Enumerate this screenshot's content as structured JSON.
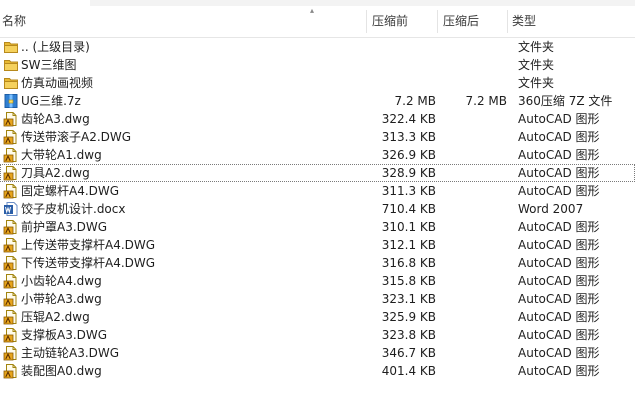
{
  "columns": {
    "name": "名称",
    "size_before": "压缩前",
    "size_after": "压缩后",
    "type": "类型"
  },
  "files": [
    {
      "name": ".. (上级目录)",
      "before": "",
      "after": "",
      "type": "文件夹",
      "icon": "folder-icon"
    },
    {
      "name": "SW三维图",
      "before": "",
      "after": "",
      "type": "文件夹",
      "icon": "folder-icon"
    },
    {
      "name": "仿真动画视频",
      "before": "",
      "after": "",
      "type": "文件夹",
      "icon": "folder-icon"
    },
    {
      "name": "UG三维.7z",
      "before": "7.2 MB",
      "after": "7.2 MB",
      "type": "360压缩 7Z 文件",
      "icon": "archive-icon"
    },
    {
      "name": "齿轮A3.dwg",
      "before": "322.4 KB",
      "after": "",
      "type": "AutoCAD 图形",
      "icon": "autocad-icon"
    },
    {
      "name": "传送带滚子A2.DWG",
      "before": "313.3 KB",
      "after": "",
      "type": "AutoCAD 图形",
      "icon": "autocad-icon"
    },
    {
      "name": "大带轮A1.dwg",
      "before": "326.9 KB",
      "after": "",
      "type": "AutoCAD 图形",
      "icon": "autocad-icon"
    },
    {
      "name": "刀具A2.dwg",
      "before": "328.9 KB",
      "after": "",
      "type": "AutoCAD 图形",
      "icon": "autocad-icon",
      "focused": true
    },
    {
      "name": "固定螺杆A4.DWG",
      "before": "311.3 KB",
      "after": "",
      "type": "AutoCAD 图形",
      "icon": "autocad-icon"
    },
    {
      "name": "饺子皮机设计.docx",
      "before": "710.4 KB",
      "after": "",
      "type": "Word 2007",
      "icon": "word-doc-icon"
    },
    {
      "name": "前护罩A3.DWG",
      "before": "310.1 KB",
      "after": "",
      "type": "AutoCAD 图形",
      "icon": "autocad-icon"
    },
    {
      "name": "上传送带支撑杆A4.DWG",
      "before": "312.1 KB",
      "after": "",
      "type": "AutoCAD 图形",
      "icon": "autocad-icon"
    },
    {
      "name": "下传送带支撑杆A4.DWG",
      "before": "316.8 KB",
      "after": "",
      "type": "AutoCAD 图形",
      "icon": "autocad-icon"
    },
    {
      "name": "小齿轮A4.dwg",
      "before": "315.8 KB",
      "after": "",
      "type": "AutoCAD 图形",
      "icon": "autocad-icon"
    },
    {
      "name": "小带轮A3.dwg",
      "before": "323.1 KB",
      "after": "",
      "type": "AutoCAD 图形",
      "icon": "autocad-icon"
    },
    {
      "name": "压辊A2.dwg",
      "before": "325.9 KB",
      "after": "",
      "type": "AutoCAD 图形",
      "icon": "autocad-icon"
    },
    {
      "name": "支撑板A3.DWG",
      "before": "323.8 KB",
      "after": "",
      "type": "AutoCAD 图形",
      "icon": "autocad-icon"
    },
    {
      "name": "主动链轮A3.DWG",
      "before": "346.7 KB",
      "after": "",
      "type": "AutoCAD 图形",
      "icon": "autocad-icon"
    },
    {
      "name": "装配图A0.dwg",
      "before": "401.4 KB",
      "after": "",
      "type": "AutoCAD 图形",
      "icon": "autocad-icon"
    }
  ],
  "colors": {
    "folder": "#e8b932",
    "autocad": "#e7a51c",
    "word": "#2a5ea8",
    "archive": "#2f7fd2"
  }
}
